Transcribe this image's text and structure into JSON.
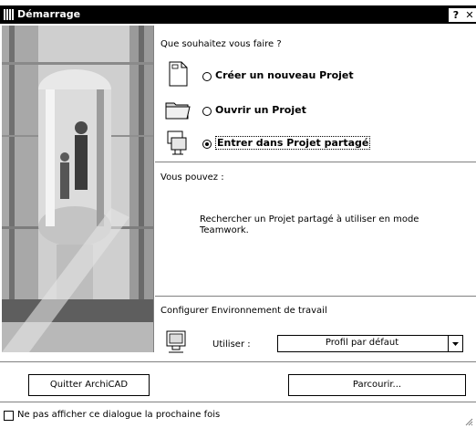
{
  "window": {
    "title": "Démarrage",
    "help_btn": "?",
    "close_btn": "✕"
  },
  "question": "Que souhaitez vous faire ?",
  "options": [
    {
      "label": "Créer un nouveau Projet",
      "selected": false,
      "icon": "document-icon"
    },
    {
      "label": "Ouvrir un Projet",
      "selected": false,
      "icon": "folder-icon"
    },
    {
      "label": "Entrer dans Projet partagé",
      "selected": true,
      "icon": "teamwork-icon"
    }
  ],
  "info": {
    "title": "Vous pouvez :",
    "text": "Rechercher un Projet partagé à utiliser en mode Teamwork."
  },
  "config": {
    "title": "Configurer Environnement de travail",
    "use_label": "Utiliser :",
    "profile_value": "Profil par défaut"
  },
  "buttons": {
    "quit": "Quitter ArchiCAD",
    "browse": "Parcourir..."
  },
  "checkbox": {
    "label": "Ne pas afficher ce dialogue la prochaine fois",
    "checked": false
  }
}
